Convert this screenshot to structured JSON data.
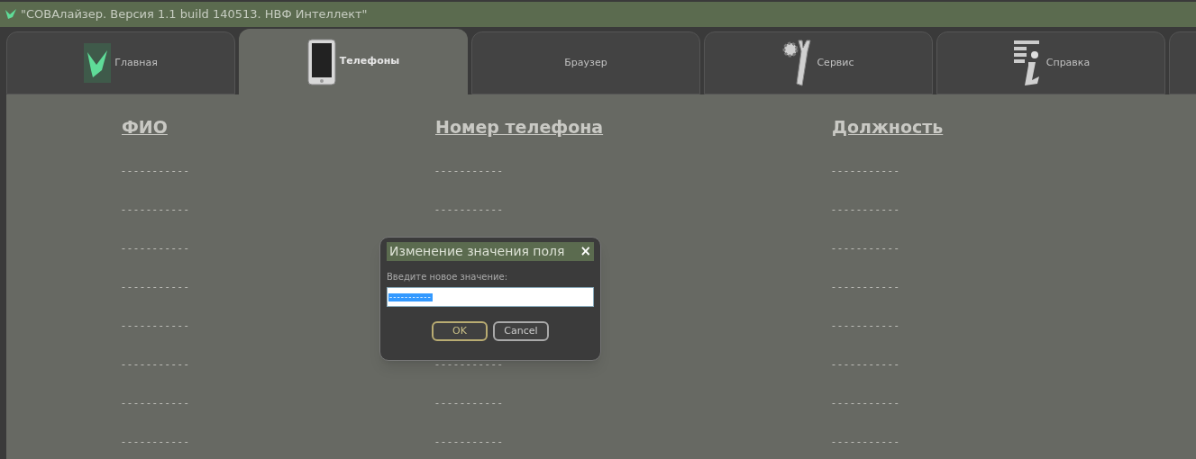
{
  "window": {
    "title": "\"СОВАлайзер. Версия 1.1 build 140513. НВФ Интеллект\""
  },
  "tabs": [
    {
      "label": "Главная",
      "kind": "bird",
      "selected": false
    },
    {
      "label": "Телефоны",
      "kind": "tablet",
      "selected": true
    },
    {
      "label": "Браузер",
      "kind": "plain",
      "selected": false
    },
    {
      "label": "Сервис",
      "kind": "tools",
      "selected": false
    },
    {
      "label": "Справка",
      "kind": "info",
      "selected": false
    }
  ],
  "table": {
    "columns": [
      "ФИО",
      "Номер телефона",
      "Должность"
    ],
    "rows": [
      {
        "name": "-----------",
        "phone": "-----------",
        "position": "-----------"
      },
      {
        "name": "-----------",
        "phone": "-----------",
        "position": "-----------"
      },
      {
        "name": "-----------",
        "position": "-----------"
      },
      {
        "name": "-----------",
        "position": "-----------"
      },
      {
        "name": "-----------",
        "position": "-----------"
      },
      {
        "name": "-----------",
        "phone": "-----------",
        "position": "-----------"
      },
      {
        "name": "-----------",
        "phone": "-----------",
        "position": "-----------"
      },
      {
        "name": "-----------",
        "phone": "-----------",
        "position": "-----------"
      }
    ]
  },
  "dialog": {
    "title": "Изменение значения поля",
    "close": "×",
    "prompt": "Введите новое значение:",
    "value": "-----------",
    "buttons": [
      "OK",
      "Cancel"
    ]
  }
}
